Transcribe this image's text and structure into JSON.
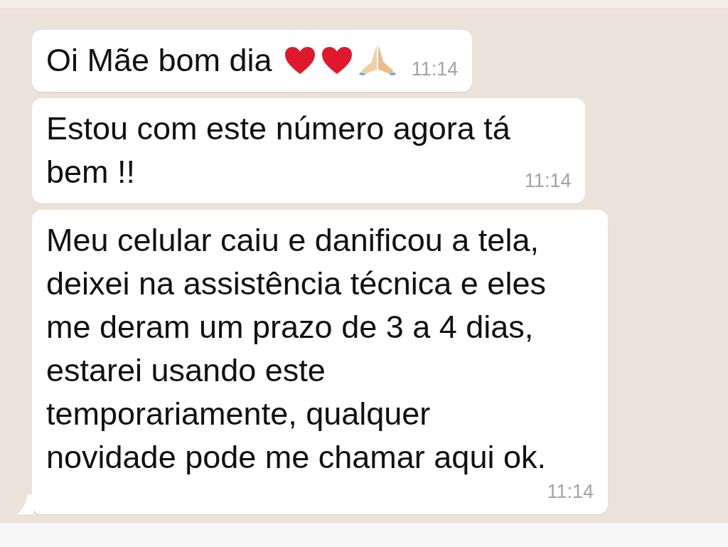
{
  "messages": [
    {
      "lines": [
        "Oi Mãe bom dia"
      ],
      "icons": [
        {
          "kind": "heart"
        },
        {
          "kind": "heart"
        },
        {
          "kind": "praying-hands"
        }
      ],
      "time": "11:14",
      "tail": false
    },
    {
      "lines": [
        "Estou com este número agora tá",
        "bem !!"
      ],
      "time": "11:14",
      "tail": false
    },
    {
      "lines": [
        "Meu celular caiu e danificou a tela,",
        "deixei na assistência técnica e eles",
        "me deram um prazo de 3 a 4 dias,",
        "estarei usando este",
        "temporariamente, qualquer",
        "novidade pode me chamar aqui ok."
      ],
      "time": "11:14",
      "tail": true
    }
  ]
}
